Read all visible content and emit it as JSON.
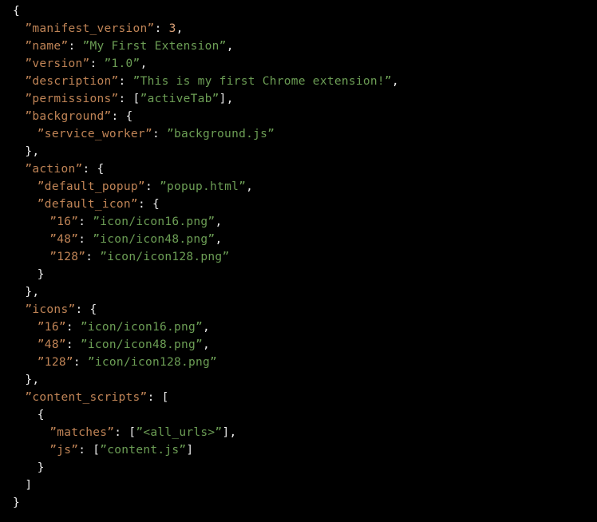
{
  "editor": {
    "background_color": "#000000",
    "key_color": "#c08456",
    "string_color": "#6c9e55",
    "punctuation_color": "#eeeeee",
    "number_color": "#d9a077",
    "quote_char": "”"
  },
  "document": {
    "language": "json",
    "lines": [
      {
        "indent": 0,
        "tokens": [
          {
            "type": "punct",
            "text": "{"
          }
        ]
      },
      {
        "indent": 1,
        "tokens": [
          {
            "type": "key",
            "text": "”manifest_version”"
          },
          {
            "type": "punct",
            "text": ": "
          },
          {
            "type": "num",
            "text": "3"
          },
          {
            "type": "punct",
            "text": ","
          }
        ]
      },
      {
        "indent": 1,
        "tokens": [
          {
            "type": "key",
            "text": "”name”"
          },
          {
            "type": "punct",
            "text": ": "
          },
          {
            "type": "str",
            "text": "”My First Extension”"
          },
          {
            "type": "punct",
            "text": ","
          }
        ]
      },
      {
        "indent": 1,
        "tokens": [
          {
            "type": "key",
            "text": "”version”"
          },
          {
            "type": "punct",
            "text": ": "
          },
          {
            "type": "str",
            "text": "”1.0”"
          },
          {
            "type": "punct",
            "text": ","
          }
        ]
      },
      {
        "indent": 1,
        "tokens": [
          {
            "type": "key",
            "text": "”description”"
          },
          {
            "type": "punct",
            "text": ": "
          },
          {
            "type": "str",
            "text": "”This is my first Chrome extension!”"
          },
          {
            "type": "punct",
            "text": ","
          }
        ]
      },
      {
        "indent": 1,
        "tokens": [
          {
            "type": "key",
            "text": "”permissions”"
          },
          {
            "type": "punct",
            "text": ": ["
          },
          {
            "type": "str",
            "text": "”activeTab”"
          },
          {
            "type": "punct",
            "text": "],"
          }
        ]
      },
      {
        "indent": 1,
        "tokens": [
          {
            "type": "key",
            "text": "”background”"
          },
          {
            "type": "punct",
            "text": ": {"
          }
        ]
      },
      {
        "indent": 2,
        "tokens": [
          {
            "type": "key",
            "text": "”service_worker”"
          },
          {
            "type": "punct",
            "text": ": "
          },
          {
            "type": "str",
            "text": "”background.js”"
          }
        ]
      },
      {
        "indent": 1,
        "tokens": [
          {
            "type": "punct",
            "text": "},"
          }
        ]
      },
      {
        "indent": 1,
        "tokens": [
          {
            "type": "key",
            "text": "”action”"
          },
          {
            "type": "punct",
            "text": ": {"
          }
        ]
      },
      {
        "indent": 2,
        "tokens": [
          {
            "type": "key",
            "text": "”default_popup”"
          },
          {
            "type": "punct",
            "text": ": "
          },
          {
            "type": "str",
            "text": "”popup.html”"
          },
          {
            "type": "punct",
            "text": ","
          }
        ]
      },
      {
        "indent": 2,
        "tokens": [
          {
            "type": "key",
            "text": "”default_icon”"
          },
          {
            "type": "punct",
            "text": ": {"
          }
        ]
      },
      {
        "indent": 3,
        "tokens": [
          {
            "type": "key",
            "text": "”16”"
          },
          {
            "type": "punct",
            "text": ": "
          },
          {
            "type": "str",
            "text": "”icon/icon16.png”"
          },
          {
            "type": "punct",
            "text": ","
          }
        ]
      },
      {
        "indent": 3,
        "tokens": [
          {
            "type": "key",
            "text": "”48”"
          },
          {
            "type": "punct",
            "text": ": "
          },
          {
            "type": "str",
            "text": "”icon/icon48.png”"
          },
          {
            "type": "punct",
            "text": ","
          }
        ]
      },
      {
        "indent": 3,
        "tokens": [
          {
            "type": "key",
            "text": "”128”"
          },
          {
            "type": "punct",
            "text": ": "
          },
          {
            "type": "str",
            "text": "”icon/icon128.png”"
          }
        ]
      },
      {
        "indent": 2,
        "tokens": [
          {
            "type": "punct",
            "text": "}"
          }
        ]
      },
      {
        "indent": 1,
        "tokens": [
          {
            "type": "punct",
            "text": "},"
          }
        ]
      },
      {
        "indent": 1,
        "tokens": [
          {
            "type": "key",
            "text": "”icons”"
          },
          {
            "type": "punct",
            "text": ": {"
          }
        ]
      },
      {
        "indent": 2,
        "tokens": [
          {
            "type": "key",
            "text": "”16”"
          },
          {
            "type": "punct",
            "text": ": "
          },
          {
            "type": "str",
            "text": "”icon/icon16.png”"
          },
          {
            "type": "punct",
            "text": ","
          }
        ]
      },
      {
        "indent": 2,
        "tokens": [
          {
            "type": "key",
            "text": "”48”"
          },
          {
            "type": "punct",
            "text": ": "
          },
          {
            "type": "str",
            "text": "”icon/icon48.png”"
          },
          {
            "type": "punct",
            "text": ","
          }
        ]
      },
      {
        "indent": 2,
        "tokens": [
          {
            "type": "key",
            "text": "”128”"
          },
          {
            "type": "punct",
            "text": ": "
          },
          {
            "type": "str",
            "text": "”icon/icon128.png”"
          }
        ]
      },
      {
        "indent": 1,
        "tokens": [
          {
            "type": "punct",
            "text": "},"
          }
        ]
      },
      {
        "indent": 1,
        "tokens": [
          {
            "type": "key",
            "text": "”content_scripts”"
          },
          {
            "type": "punct",
            "text": ": ["
          }
        ]
      },
      {
        "indent": 2,
        "tokens": [
          {
            "type": "punct",
            "text": "{"
          }
        ]
      },
      {
        "indent": 3,
        "tokens": [
          {
            "type": "key",
            "text": "”matches”"
          },
          {
            "type": "punct",
            "text": ": ["
          },
          {
            "type": "str",
            "text": "”<all_urls>”"
          },
          {
            "type": "punct",
            "text": "],"
          }
        ]
      },
      {
        "indent": 3,
        "tokens": [
          {
            "type": "key",
            "text": "”js”"
          },
          {
            "type": "punct",
            "text": ": ["
          },
          {
            "type": "str",
            "text": "”content.js”"
          },
          {
            "type": "punct",
            "text": "]"
          }
        ]
      },
      {
        "indent": 2,
        "tokens": [
          {
            "type": "punct",
            "text": "}"
          }
        ]
      },
      {
        "indent": 1,
        "tokens": [
          {
            "type": "punct",
            "text": "]"
          }
        ]
      },
      {
        "indent": 0,
        "tokens": [
          {
            "type": "punct",
            "text": "}"
          }
        ]
      }
    ]
  }
}
